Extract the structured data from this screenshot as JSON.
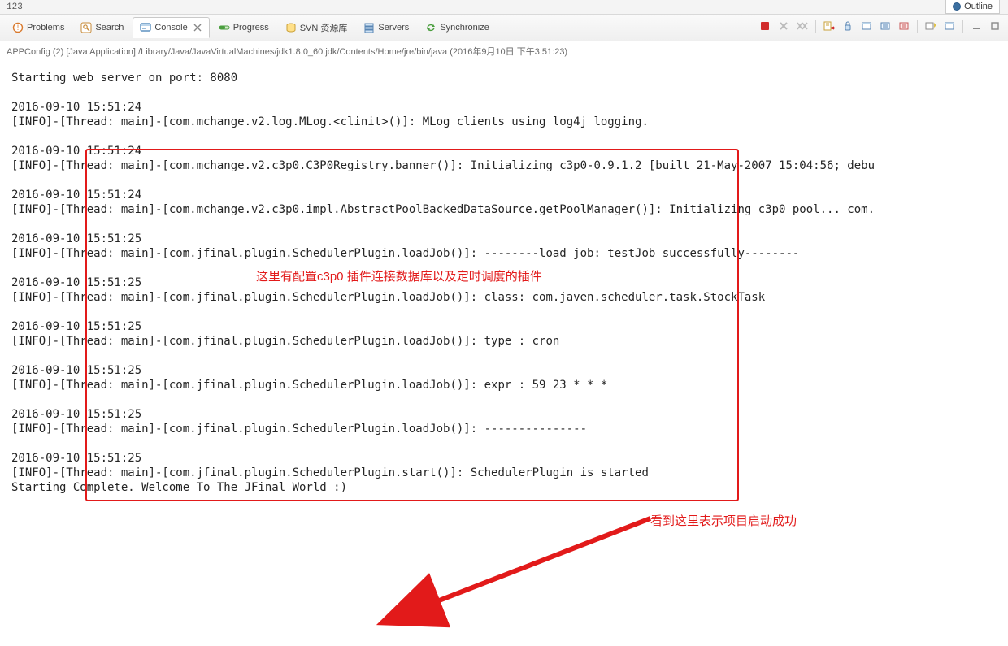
{
  "topbar": {
    "left_text": "123"
  },
  "outline_view": {
    "label": "Outline"
  },
  "tabs": {
    "problems": {
      "label": "Problems"
    },
    "search": {
      "label": "Search"
    },
    "console": {
      "label": "Console"
    },
    "progress": {
      "label": "Progress"
    },
    "svn": {
      "label": "SVN 资源库"
    },
    "servers": {
      "label": "Servers"
    },
    "synchronize": {
      "label": "Synchronize"
    }
  },
  "run_config": "APPConfig (2) [Java Application] /Library/Java/JavaVirtualMachines/jdk1.8.0_60.jdk/Contents/Home/jre/bin/java (2016年9月10日 下午3:51:23)",
  "annotation1": "这里有配置c3p0 插件连接数据库以及定时调度的插件",
  "annotation2": "看到这里表示项目启动成功",
  "console": {
    "l00": "Starting web server on port: 8080",
    "l01": "",
    "l02": "2016-09-10 15:51:24",
    "l03": "[INFO]-[Thread: main]-[com.mchange.v2.log.MLog.<clinit>()]: MLog clients using log4j logging.",
    "l04": "",
    "l05": "2016-09-10 15:51:24",
    "l06": "[INFO]-[Thread: main]-[com.mchange.v2.c3p0.C3P0Registry.banner()]: Initializing c3p0-0.9.1.2 [built 21-May-2007 15:04:56; debu",
    "l07": "",
    "l08": "2016-09-10 15:51:24",
    "l09": "[INFO]-[Thread: main]-[com.mchange.v2.c3p0.impl.AbstractPoolBackedDataSource.getPoolManager()]: Initializing c3p0 pool... com.",
    "l10": "",
    "l11": "2016-09-10 15:51:25",
    "l12": "[INFO]-[Thread: main]-[com.jfinal.plugin.SchedulerPlugin.loadJob()]: --------load job: testJob successfully--------",
    "l13": "",
    "l14": "2016-09-10 15:51:25",
    "l15": "[INFO]-[Thread: main]-[com.jfinal.plugin.SchedulerPlugin.loadJob()]: class: com.javen.scheduler.task.StockTask",
    "l16": "",
    "l17": "2016-09-10 15:51:25",
    "l18": "[INFO]-[Thread: main]-[com.jfinal.plugin.SchedulerPlugin.loadJob()]: type : cron",
    "l19": "",
    "l20": "2016-09-10 15:51:25",
    "l21": "[INFO]-[Thread: main]-[com.jfinal.plugin.SchedulerPlugin.loadJob()]: expr : 59 23 * * *",
    "l22": "",
    "l23": "2016-09-10 15:51:25",
    "l24": "[INFO]-[Thread: main]-[com.jfinal.plugin.SchedulerPlugin.loadJob()]: ---------------",
    "l25": "",
    "l26": "2016-09-10 15:51:25",
    "l27": "[INFO]-[Thread: main]-[com.jfinal.plugin.SchedulerPlugin.start()]: SchedulerPlugin is started",
    "l28": "Starting Complete. Welcome To The JFinal World :)"
  }
}
